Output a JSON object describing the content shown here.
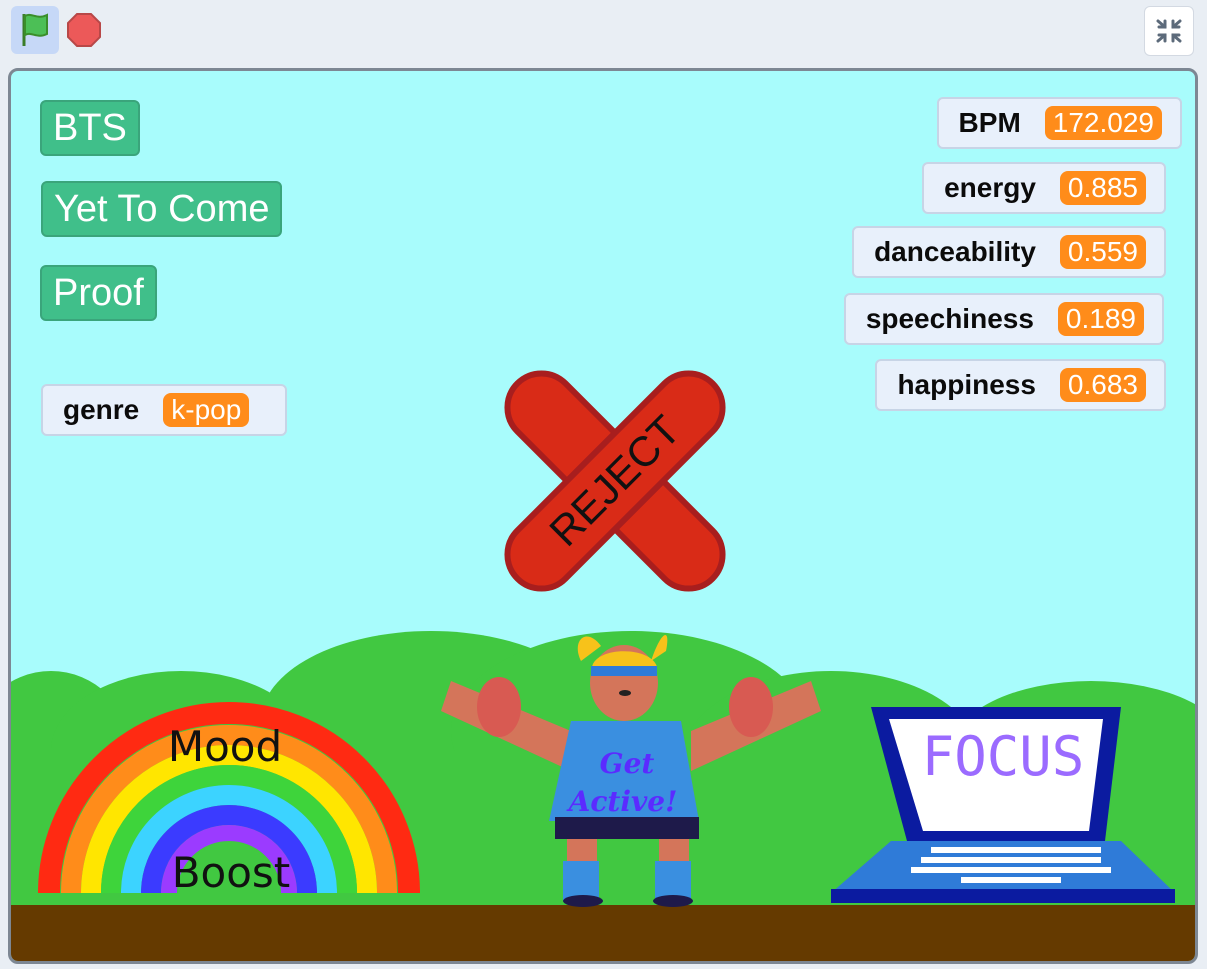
{
  "toolbar": {
    "green_flag_icon": "green-flag-icon",
    "stop_icon": "stop-sign-icon",
    "fullscreen_icon": "exit-fullscreen-icon"
  },
  "stage": {
    "buttons": [
      {
        "label": "BTS"
      },
      {
        "label": "Yet To Come"
      },
      {
        "label": "Proof"
      }
    ],
    "genre_monitor": {
      "label": "genre",
      "value": "k-pop"
    },
    "monitors": [
      {
        "label": "BPM",
        "value": "172.029"
      },
      {
        "label": "energy",
        "value": "0.885"
      },
      {
        "label": "danceability",
        "value": "0.559"
      },
      {
        "label": "speechiness",
        "value": "0.189"
      },
      {
        "label": "happiness",
        "value": "0.683"
      }
    ],
    "reject_label": "REJECT",
    "rainbow": {
      "line1": "Mood",
      "line2": "Boost"
    },
    "character_shirt": {
      "line1": "Get",
      "line2": "Active!"
    },
    "laptop_screen_text": "FOCUS"
  },
  "colors": {
    "sky": "#a8fcfc",
    "hills": "#41c841",
    "ground": "#653a00",
    "button_green": "#40bf8a",
    "monitor_orange": "#ff8c1a",
    "reject_red": "#d92b17"
  }
}
